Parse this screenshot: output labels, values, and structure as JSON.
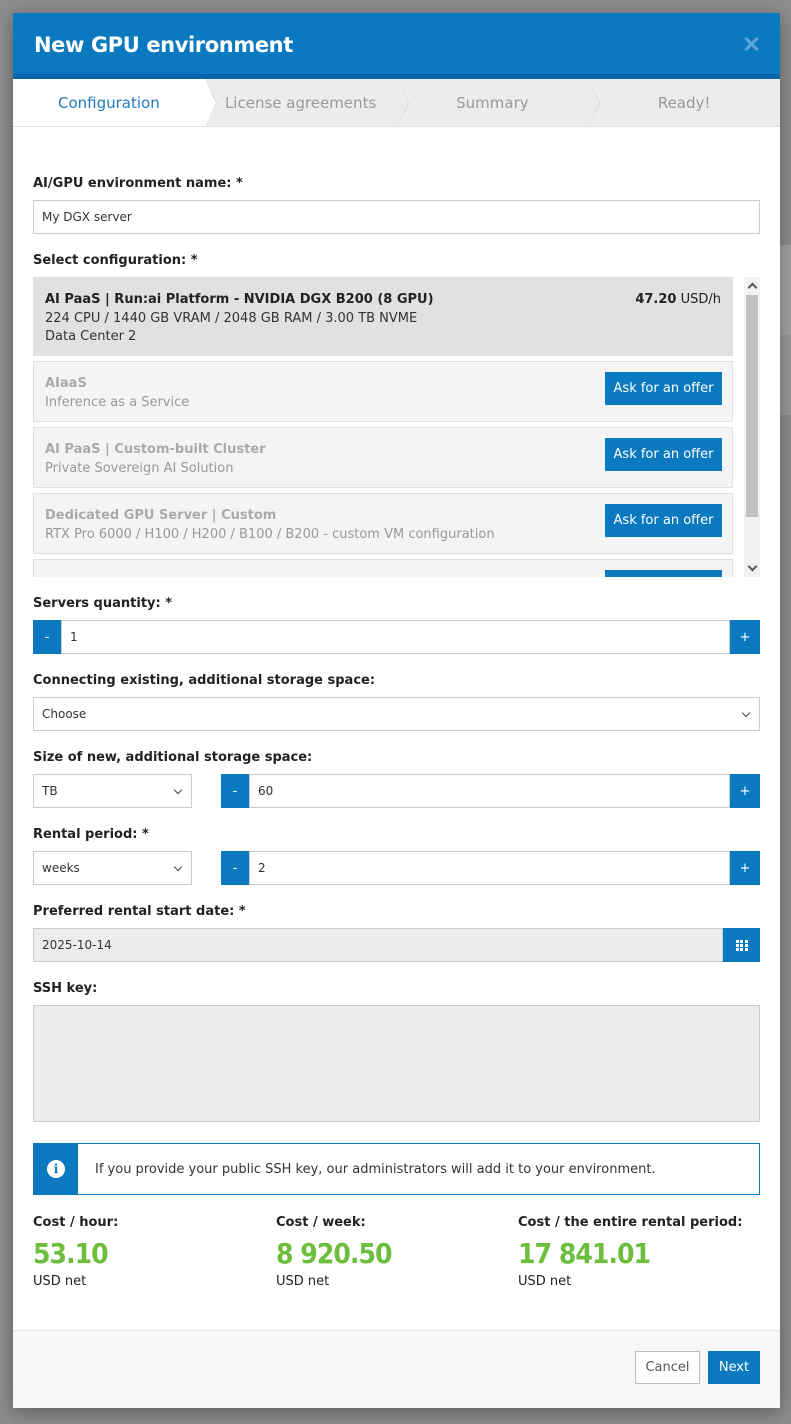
{
  "modal": {
    "title": "New GPU environment",
    "close_icon": "close-icon"
  },
  "steps": [
    {
      "label": "Configuration",
      "active": true
    },
    {
      "label": "License agreements",
      "active": false
    },
    {
      "label": "Summary",
      "active": false
    },
    {
      "label": "Ready!",
      "active": false
    }
  ],
  "env_name": {
    "label": "AI/GPU environment name: *",
    "value": "My DGX server"
  },
  "config": {
    "label": "Select configuration: *",
    "items": [
      {
        "title": "AI PaaS | Run:ai Platform - NVIDIA DGX B200 (8 GPU)",
        "line1": "224 CPU / 1440 GB VRAM / 2048 GB RAM / 3.00 TB NVME",
        "line2": "Data Center 2",
        "price": "47.20",
        "price_unit": "USD/h",
        "selected": true
      },
      {
        "title": "AIaaS",
        "line1": "Inference as a Service",
        "button": "Ask for an offer"
      },
      {
        "title": "AI PaaS | Custom-built Cluster",
        "line1": "Private Sovereign AI Solution",
        "button": "Ask for an offer"
      },
      {
        "title": "Dedicated GPU Server | Custom",
        "line1": "RTX Pro 6000 / H100 / H200 / B100 / B200 - custom VM configuration",
        "button": "Ask for an offer"
      }
    ]
  },
  "servers_quantity": {
    "label": "Servers quantity: *",
    "value": "1",
    "minus": "-",
    "plus": "+"
  },
  "existing_storage": {
    "label": "Connecting existing, additional storage space:",
    "value": "Choose"
  },
  "new_storage": {
    "label": "Size of new, additional storage space:",
    "unit": "TB",
    "value": "60",
    "minus": "-",
    "plus": "+"
  },
  "rental_period": {
    "label": "Rental period: *",
    "unit": "weeks",
    "value": "2",
    "minus": "-",
    "plus": "+"
  },
  "start_date": {
    "label": "Preferred rental start date: *",
    "value": "2025-10-14"
  },
  "ssh": {
    "label": "SSH key:",
    "value": ""
  },
  "info": {
    "text": "If you provide your public SSH key, our administrators will add it to your environment."
  },
  "costs": [
    {
      "label": "Cost / hour:",
      "value": "53.10",
      "unit": "USD net"
    },
    {
      "label": "Cost / week:",
      "value": "8 920.50",
      "unit": "USD net"
    },
    {
      "label": "Cost / the entire rental period:",
      "value": "17 841.01",
      "unit": "USD net"
    }
  ],
  "footer": {
    "cancel": "Cancel",
    "next": "Next"
  },
  "colors": {
    "accent": "#0a79bf",
    "cost_green": "#6cbf3c"
  }
}
